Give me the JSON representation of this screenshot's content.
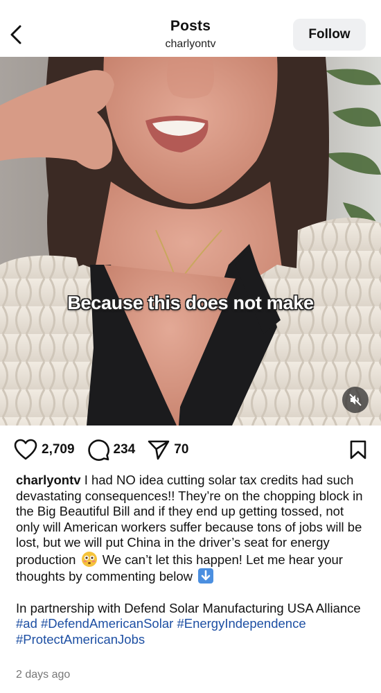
{
  "header": {
    "title": "Posts",
    "subtitle": "charlyontv",
    "follow_label": "Follow",
    "back_icon": "chevron-left-icon"
  },
  "media": {
    "subtitle_text": "Because this does not make",
    "mute_icon": "speaker-muted-icon"
  },
  "actions": {
    "likes": "2,709",
    "comments": "234",
    "shares": "70",
    "icons": [
      "heart-icon",
      "comment-icon",
      "share-icon",
      "bookmark-icon"
    ]
  },
  "post": {
    "username": "charlyontv",
    "body_1": "I had NO idea cutting solar tax credits had such devastating consequences!! They’re on the chopping block in the Big Beautiful Bill and if they end up getting tossed, not only will American workers suffer because tons of jobs will be lost, but we will put China in the driver’s seat for energy production",
    "body_2": "We can’t let this happen! Let me hear your thoughts by commenting below",
    "partnership": "In partnership with Defend Solar Manufacturing USA Alliance",
    "hashtags": [
      "#ad",
      "#DefendAmericanSolar",
      "#EnergyIndependence",
      "#ProtectAmericanJobs"
    ],
    "emojis": [
      "flushed-face-emoji",
      "down-arrow-emoji"
    ],
    "timestamp": "2 days ago"
  },
  "colors": {
    "link": "#1d4fa3",
    "follow_bg": "#eff0f2"
  }
}
